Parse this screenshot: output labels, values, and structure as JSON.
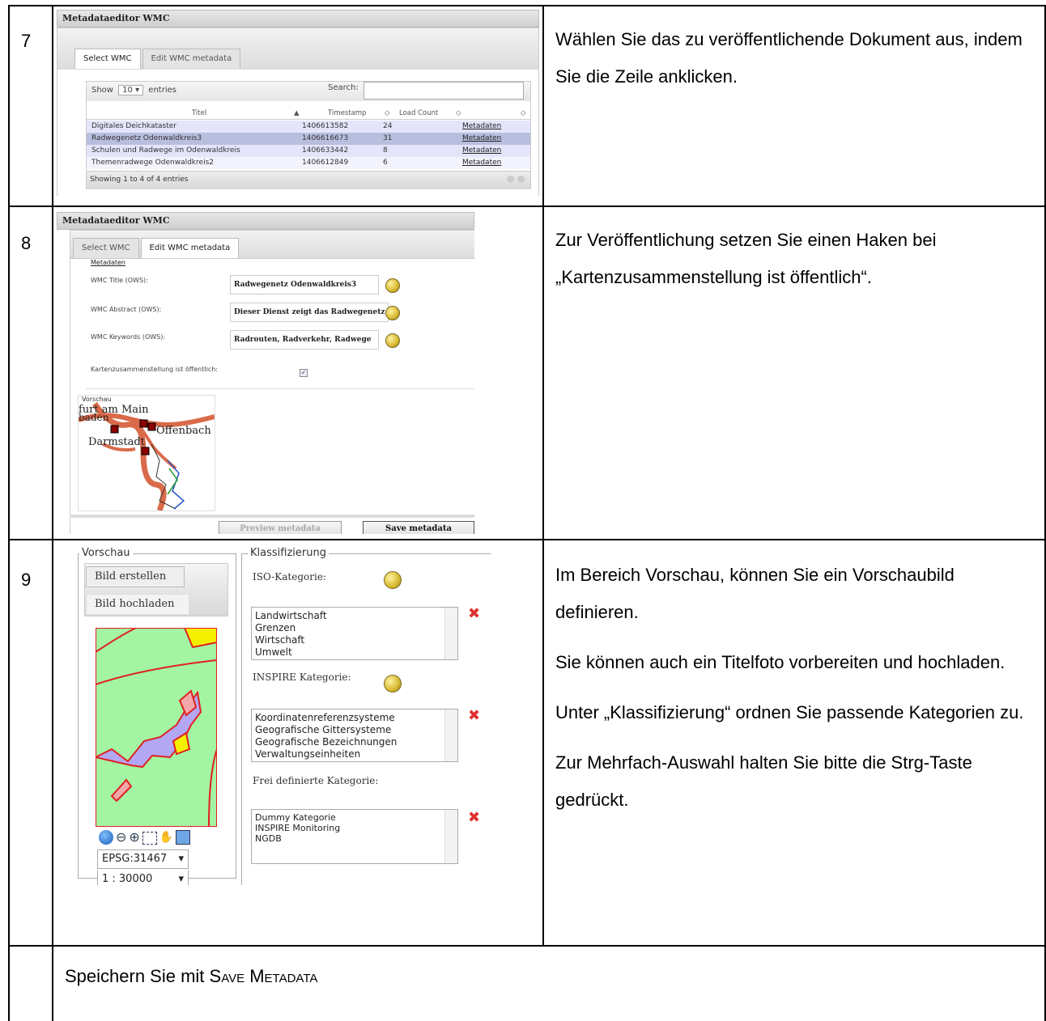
{
  "rows": [
    {
      "number": "7",
      "description": [
        "Wählen Sie das zu veröffentlichende Dokument aus, indem Sie die Zeile anklicken."
      ]
    },
    {
      "number": "8",
      "description": [
        "Zur Veröffentlichung setzen Sie einen Haken bei „Kartenzusammenstellung ist öffentlich“."
      ]
    },
    {
      "number": "9",
      "description": [
        "Im Bereich Vorschau, können Sie ein Vorschaubild definieren.",
        "Sie können auch ein Titelfoto vorbereiten und hochladen.",
        "Unter „Klassifizierung“ ordnen Sie passende Kategorien zu.",
        "Zur Mehrfach-Auswahl halten Sie bitte die Strg-Taste gedrückt."
      ]
    }
  ],
  "footer": {
    "prefix": "Speichern Sie mit ",
    "command": "Save Metadata"
  },
  "shot7": {
    "window_title": "Metadataeditor WMC",
    "tabs": [
      "Select WMC",
      "Edit WMC metadata"
    ],
    "show_label": "Show",
    "show_value": "10",
    "entries_label": "entries",
    "search_label": "Search:",
    "columns": [
      "Titel",
      "Timestamp",
      "Load Count",
      ""
    ],
    "rows": [
      {
        "titel": "Digitales Deichkataster",
        "timestamp": "1406613582",
        "count": "24",
        "link": "Metadaten"
      },
      {
        "titel": "Radwegenetz Odenwaldkreis3",
        "timestamp": "1406616673",
        "count": "31",
        "link": "Metadaten"
      },
      {
        "titel": "Schulen und Radwege im Odenwaldkreis",
        "timestamp": "1406633442",
        "count": "8",
        "link": "Metadaten"
      },
      {
        "titel": "Themenradwege Odenwaldkreis2",
        "timestamp": "1406612849",
        "count": "6",
        "link": "Metadaten"
      }
    ],
    "footer": "Showing 1 to 4 of 4 entries"
  },
  "shot8": {
    "window_title": "Metadataeditor WMC",
    "tabs": [
      "Select WMC",
      "Edit WMC metadata"
    ],
    "section": "Metadaten",
    "fields": [
      {
        "label": "WMC Title (OWS):",
        "value": "Radwegenetz Odenwaldkreis3"
      },
      {
        "label": "WMC Abstract (OWS):",
        "value": "Dieser Dienst zeigt das Radwegenetz f"
      },
      {
        "label": "WMC Keywords (OWS):",
        "value": "Radrouten, Radverkehr, Radwege"
      }
    ],
    "public_label": "Kartenzusammenstellung ist öffentlich:",
    "public_checked": true,
    "preview_label": "Vorschau",
    "map_labels": [
      "furt am Main",
      "baden",
      "Offenbach",
      "Darmstadt"
    ],
    "preview_button": "Preview metadata",
    "save_button": "Save metadata"
  },
  "shot9": {
    "vorschau_legend": "Vorschau",
    "tabs": [
      "Bild erstellen",
      "Bild hochladen"
    ],
    "epsg": "EPSG:31467",
    "scale": "1 : 30000",
    "klassifizierung_legend": "Klassifizierung",
    "iso_label": "ISO-Kategorie:",
    "iso_items": [
      "Landwirtschaft",
      "Grenzen",
      "Wirtschaft",
      "Umwelt"
    ],
    "inspire_label": "INSPIRE Kategorie:",
    "inspire_items": [
      "Koordinatenreferenzsysteme",
      "Geografische Gittersysteme",
      "Geografische Bezeichnungen",
      "Verwaltungseinheiten"
    ],
    "frei_label": "Frei definierte Kategorie:",
    "frei_items": [
      "Dummy Kategorie",
      "INSPIRE Monitoring",
      "NGDB"
    ]
  }
}
